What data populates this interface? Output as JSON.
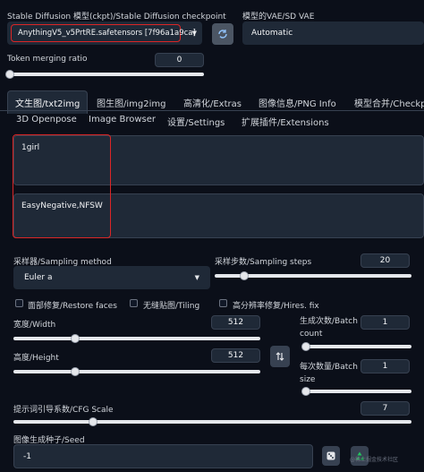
{
  "checkpoint": {
    "label": "Stable Diffusion 模型(ckpt)/Stable Diffusion checkpoint",
    "value": "AnythingV5_v5PrtRE.safetensors [7f96a1a9ca]"
  },
  "vae": {
    "label": "模型的VAE/SD VAE",
    "value": "Automatic"
  },
  "token_merging": {
    "label": "Token merging ratio",
    "value": "0",
    "level": 0
  },
  "tabs_main": [
    "文生图/txt2img",
    "图生图/img2img",
    "高清化/Extras",
    "图像信息/PNG Info",
    "模型合并/Checkp"
  ],
  "tabs_secondary": [
    "3D Openpose",
    "Image Browser",
    "设置/Settings",
    "扩展插件/Extensions"
  ],
  "prompt": {
    "positive": "1girl",
    "negative": "EasyNegative,NFSW"
  },
  "sampler": {
    "label": "采样器/Sampling method",
    "value": "Euler a"
  },
  "steps": {
    "label": "采样步数/Sampling steps",
    "value": "20",
    "level": 0.15
  },
  "checkboxes": [
    "面部修复/Restore faces",
    "无缝贴图/Tiling",
    "高分辨率修复/Hires. fix"
  ],
  "width": {
    "label": "宽度/Width",
    "value": "512",
    "level": 0.25
  },
  "height": {
    "label": "高度/Height",
    "value": "512",
    "level": 0.25
  },
  "batch_count": {
    "label_line1": "生成次数/Batch",
    "label_line2": "count",
    "value": "1",
    "level": 0
  },
  "batch_size": {
    "label_line1": "每次数量/Batch",
    "label_line2": "size",
    "value": "1",
    "level": 0
  },
  "cfg": {
    "label": "提示词引导系数/CFG Scale",
    "value": "7",
    "level": 0.2
  },
  "seed": {
    "label": "图像生成种子/Seed",
    "value": "-1"
  },
  "watermark": "@稀土掘金技术社区"
}
